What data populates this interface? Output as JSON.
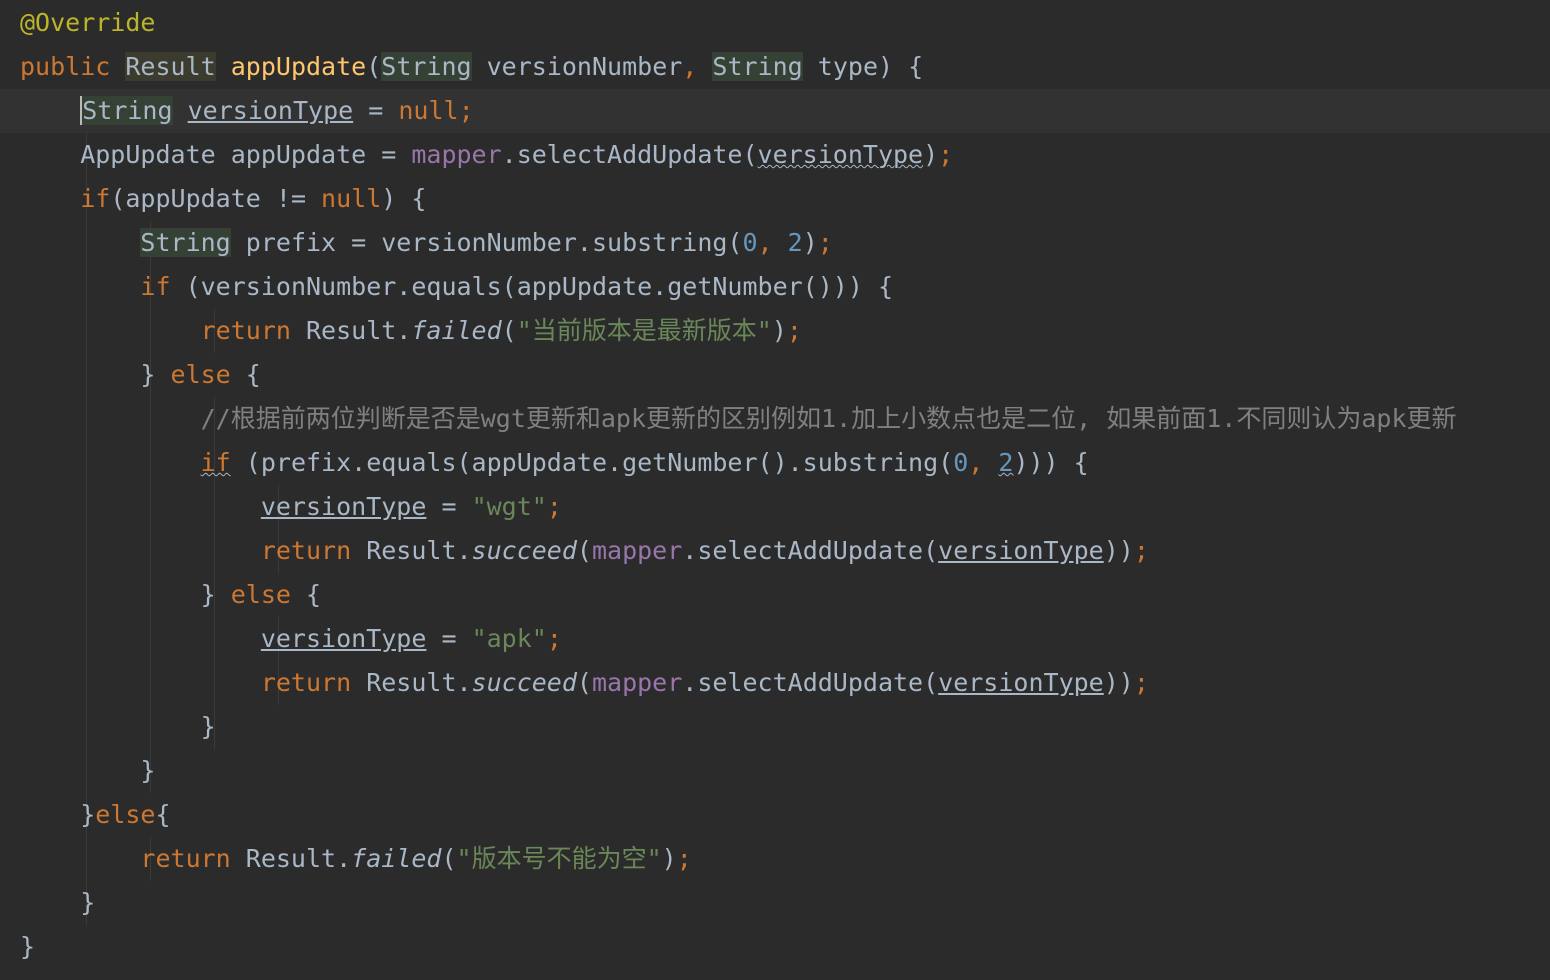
{
  "editor": {
    "language": "java",
    "theme_colors": {
      "background": "#2b2b2b",
      "keyword": "#cc7832",
      "annotation": "#bbb529",
      "method_decl": "#ffc66d",
      "field": "#9876aa",
      "string": "#6a8759",
      "number": "#6897bb",
      "comment": "#808080",
      "text": "#a9b7c6"
    },
    "lines": [
      [
        [
          "ann",
          "@Override"
        ]
      ],
      [
        [
          "k",
          "public "
        ],
        [
          "resulthl",
          "Result"
        ],
        [
          "t",
          " "
        ],
        [
          "fn",
          "appUpdate"
        ],
        [
          "t",
          "("
        ],
        [
          "typehl",
          "String"
        ],
        [
          "t",
          " versionNumber"
        ],
        [
          "k",
          ","
        ],
        [
          "t",
          " "
        ],
        [
          "typehl",
          "String"
        ],
        [
          "t",
          " type) {"
        ]
      ],
      [
        [
          "t",
          "    "
        ],
        [
          "caret",
          "S"
        ],
        [
          "typehl",
          "tring"
        ],
        [
          "t",
          " "
        ],
        [
          "lv",
          "versionType"
        ],
        [
          "t",
          " = "
        ],
        [
          "k",
          "null"
        ],
        [
          "k",
          ";"
        ]
      ],
      [
        [
          "t",
          "    AppUpdate appUpdate = "
        ],
        [
          "fld",
          "mapper"
        ],
        [
          "t",
          ".selectAddUpdate("
        ],
        [
          "squigt",
          "versionType"
        ],
        [
          "t",
          ")"
        ],
        [
          "k",
          ";"
        ]
      ],
      [
        [
          "t",
          "    "
        ],
        [
          "k",
          "if"
        ],
        [
          "t",
          "(appUpdate != "
        ],
        [
          "k",
          "null"
        ],
        [
          "t",
          ") {"
        ]
      ],
      [
        [
          "t",
          "        "
        ],
        [
          "typehl",
          "String"
        ],
        [
          "t",
          " prefix = versionNumber.substring("
        ],
        [
          "num",
          "0"
        ],
        [
          "k",
          ", "
        ],
        [
          "num",
          "2"
        ],
        [
          "t",
          ")"
        ],
        [
          "k",
          ";"
        ]
      ],
      [
        [
          "t",
          "        "
        ],
        [
          "k",
          "if"
        ],
        [
          "t",
          " (versionNumber.equals(appUpdate.getNumber())) {"
        ]
      ],
      [
        [
          "t",
          "            "
        ],
        [
          "k",
          "return "
        ],
        [
          "t",
          "Result."
        ],
        [
          "it",
          "failed"
        ],
        [
          "t",
          "("
        ],
        [
          "str",
          "\"当前版本是最新版本\""
        ],
        [
          "t",
          ")"
        ],
        [
          "k",
          ";"
        ]
      ],
      [
        [
          "t",
          "        } "
        ],
        [
          "k",
          "else"
        ],
        [
          "t",
          " {"
        ]
      ],
      [
        [
          "t",
          "            "
        ],
        [
          "cm",
          "//根据前两位判断是否是wgt更新和apk更新的区别例如1.加上小数点也是二位, 如果前面1.不同则认为apk更新"
        ]
      ],
      [
        [
          "t",
          "            "
        ],
        [
          "squigk",
          "if"
        ],
        [
          "t",
          " (prefix.equals(appUpdate.getNumber().substring("
        ],
        [
          "num",
          "0"
        ],
        [
          "k",
          ", "
        ],
        [
          "squign",
          "2"
        ],
        [
          "t",
          "))) {"
        ]
      ],
      [
        [
          "t",
          "                "
        ],
        [
          "lv",
          "versionType"
        ],
        [
          "t",
          " = "
        ],
        [
          "str",
          "\"wgt\""
        ],
        [
          "k",
          ";"
        ]
      ],
      [
        [
          "t",
          "                "
        ],
        [
          "k",
          "return "
        ],
        [
          "t",
          "Result."
        ],
        [
          "it",
          "succeed"
        ],
        [
          "t",
          "("
        ],
        [
          "fld",
          "mapper"
        ],
        [
          "t",
          ".selectAddUpdate("
        ],
        [
          "lv",
          "versionType"
        ],
        [
          "t",
          "))"
        ],
        [
          "k",
          ";"
        ]
      ],
      [
        [
          "t",
          "            } "
        ],
        [
          "k",
          "else"
        ],
        [
          "t",
          " {"
        ]
      ],
      [
        [
          "t",
          "                "
        ],
        [
          "lv",
          "versionType"
        ],
        [
          "t",
          " = "
        ],
        [
          "str",
          "\"apk\""
        ],
        [
          "k",
          ";"
        ]
      ],
      [
        [
          "t",
          "                "
        ],
        [
          "k",
          "return "
        ],
        [
          "t",
          "Result."
        ],
        [
          "it",
          "succeed"
        ],
        [
          "t",
          "("
        ],
        [
          "fld",
          "mapper"
        ],
        [
          "t",
          ".selectAddUpdate("
        ],
        [
          "lv",
          "versionType"
        ],
        [
          "t",
          "))"
        ],
        [
          "k",
          ";"
        ]
      ],
      [
        [
          "t",
          "            }"
        ]
      ],
      [
        [
          "t",
          "        }"
        ]
      ],
      [
        [
          "t",
          "    }"
        ],
        [
          "k",
          "else"
        ],
        [
          "t",
          "{"
        ]
      ],
      [
        [
          "t",
          "        "
        ],
        [
          "k",
          "return "
        ],
        [
          "t",
          "Result."
        ],
        [
          "it",
          "failed"
        ],
        [
          "t",
          "("
        ],
        [
          "str",
          "\"版本号不能为空\""
        ],
        [
          "t",
          ")"
        ],
        [
          "k",
          ";"
        ]
      ],
      [
        [
          "t",
          "    }"
        ]
      ],
      [
        [
          "t",
          "}"
        ]
      ]
    ],
    "current_line": 2
  }
}
